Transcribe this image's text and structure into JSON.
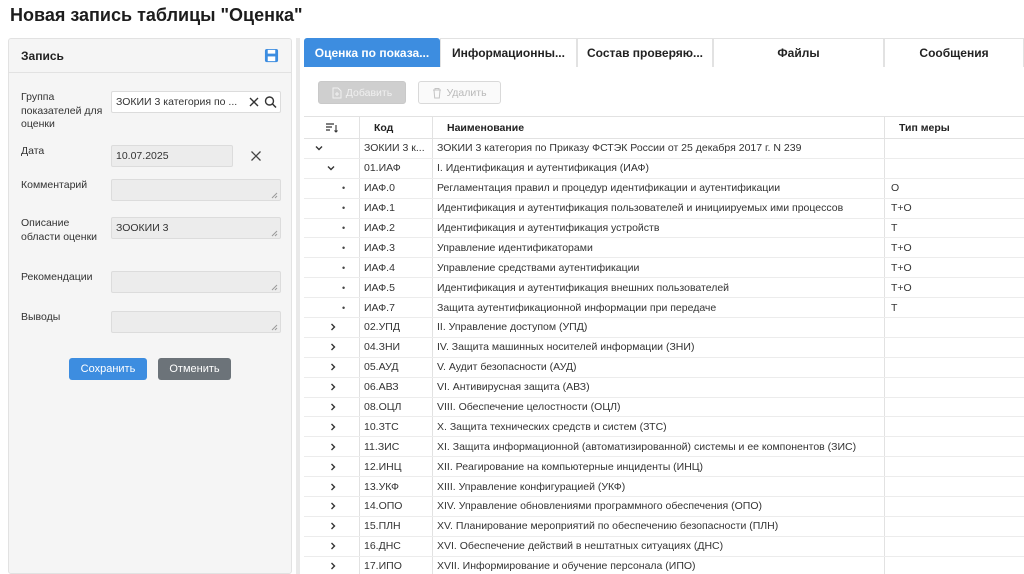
{
  "page": {
    "title": "Новая запись таблицы \"Оценка\""
  },
  "record": {
    "title": "Запись",
    "fields": {
      "group": {
        "label": "Группа показателей для оценки",
        "value": "ЗОКИИ 3 категория по ..."
      },
      "date": {
        "label": "Дата",
        "value": "10.07.2025"
      },
      "comment": {
        "label": "Комментарий",
        "value": ""
      },
      "scope": {
        "label": "Описание области оценки",
        "value": "ЗООКИИ 3"
      },
      "recommendations": {
        "label": "Рекомендации",
        "value": ""
      },
      "conclusions": {
        "label": "Выводы",
        "value": ""
      }
    },
    "save_label": "Сохранить",
    "cancel_label": "Отменить"
  },
  "tabs": [
    {
      "label": "Оценка по показа...",
      "active": true
    },
    {
      "label": "Информационны...",
      "active": false
    },
    {
      "label": "Состав проверяю...",
      "active": false
    },
    {
      "label": "Файлы",
      "active": false
    },
    {
      "label": "Сообщения",
      "active": false
    }
  ],
  "toolbar": {
    "add_label": "Добавить",
    "delete_label": "Удалить"
  },
  "grid": {
    "columns": {
      "code": "Код",
      "name": "Наименование",
      "type": "Тип меры"
    },
    "rows": [
      {
        "level": "root",
        "expander": "down",
        "code": "ЗОКИИ 3 к...",
        "name": "ЗОКИИ 3 категория по Приказу ФСТЭК России от 25 декабря 2017 г. N 239",
        "type": ""
      },
      {
        "level": "group-open",
        "expander": "down",
        "code": "01.ИАФ",
        "name": "I. Идентификация и аутентификация (ИАФ)",
        "type": ""
      },
      {
        "level": "leaf",
        "expander": "bullet",
        "code": "ИАФ.0",
        "name": "Регламентация правил и процедур идентификации и аутентификации",
        "type": "О"
      },
      {
        "level": "leaf",
        "expander": "bullet",
        "code": "ИАФ.1",
        "name": "Идентификация и аутентификация пользователей и инициируемых ими процессов",
        "type": "Т+О"
      },
      {
        "level": "leaf",
        "expander": "bullet",
        "code": "ИАФ.2",
        "name": "Идентификация и аутентификация устройств",
        "type": "Т"
      },
      {
        "level": "leaf",
        "expander": "bullet",
        "code": "ИАФ.3",
        "name": "Управление идентификаторами",
        "type": "Т+О"
      },
      {
        "level": "leaf",
        "expander": "bullet",
        "code": "ИАФ.4",
        "name": "Управление средствами аутентификации",
        "type": "Т+О"
      },
      {
        "level": "leaf",
        "expander": "bullet",
        "code": "ИАФ.5",
        "name": "Идентификация и аутентификация внешних пользователей",
        "type": "Т+О"
      },
      {
        "level": "leaf",
        "expander": "bullet",
        "code": "ИАФ.7",
        "name": "Защита аутентификационной информации при передаче",
        "type": "Т"
      },
      {
        "level": "group",
        "expander": "right",
        "code": "02.УПД",
        "name": "II. Управление доступом (УПД)",
        "type": ""
      },
      {
        "level": "group",
        "expander": "right",
        "code": "04.ЗНИ",
        "name": "IV. Защита машинных носителей информации (ЗНИ)",
        "type": ""
      },
      {
        "level": "group",
        "expander": "right",
        "code": "05.АУД",
        "name": "V. Аудит безопасности (АУД)",
        "type": ""
      },
      {
        "level": "group",
        "expander": "right",
        "code": "06.АВЗ",
        "name": "VI. Антивирусная защита (АВЗ)",
        "type": ""
      },
      {
        "level": "group",
        "expander": "right",
        "code": "08.ОЦЛ",
        "name": "VIII. Обеспечение целостности (ОЦЛ)",
        "type": ""
      },
      {
        "level": "group",
        "expander": "right",
        "code": "10.ЗТС",
        "name": "X. Защита технических средств и систем (ЗТС)",
        "type": ""
      },
      {
        "level": "group",
        "expander": "right",
        "code": "11.ЗИС",
        "name": "XI. Защита информационной (автоматизированной) системы и ее компонентов (ЗИС)",
        "type": ""
      },
      {
        "level": "group",
        "expander": "right",
        "code": "12.ИНЦ",
        "name": "XII. Реагирование на компьютерные инциденты (ИНЦ)",
        "type": ""
      },
      {
        "level": "group",
        "expander": "right",
        "code": "13.УКФ",
        "name": "XIII. Управление конфигурацией (УКФ)",
        "type": ""
      },
      {
        "level": "group",
        "expander": "right",
        "code": "14.ОПО",
        "name": "XIV. Управление обновлениями программного обеспечения (ОПО)",
        "type": ""
      },
      {
        "level": "group",
        "expander": "right",
        "code": "15.ПЛН",
        "name": "XV. Планирование мероприятий по обеспечению безопасности (ПЛН)",
        "type": ""
      },
      {
        "level": "group",
        "expander": "right",
        "code": "16.ДНС",
        "name": "XVI. Обеспечение действий в нештатных ситуациях (ДНС)",
        "type": ""
      },
      {
        "level": "group",
        "expander": "right",
        "code": "17.ИПО",
        "name": "XVII. Информирование и обучение персонала (ИПО)",
        "type": ""
      }
    ]
  },
  "colors": {
    "accent": "#3d8de0",
    "secondary_button": "#6c7379"
  }
}
